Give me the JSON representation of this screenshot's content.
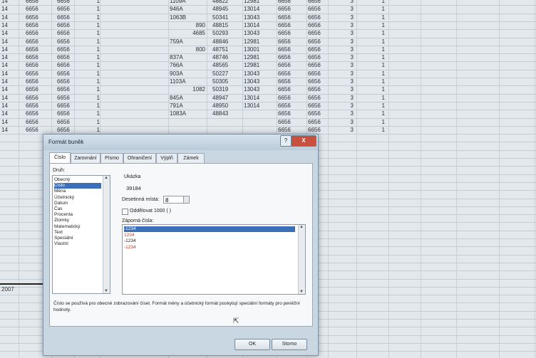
{
  "spreadsheet": {
    "left_rows": [
      [
        "14",
        "6656",
        "6656",
        "1"
      ],
      [
        "14",
        "6656",
        "6656",
        "1"
      ],
      [
        "14",
        "6656",
        "6656",
        "1"
      ],
      [
        "14",
        "6656",
        "6656",
        "1"
      ],
      [
        "14",
        "6656",
        "6656",
        "1"
      ],
      [
        "14",
        "6656",
        "6656",
        "1"
      ],
      [
        "14",
        "6656",
        "6656",
        "1"
      ],
      [
        "14",
        "6656",
        "6656",
        "1"
      ],
      [
        "14",
        "6656",
        "6656",
        "1"
      ],
      [
        "14",
        "6656",
        "6656",
        "1"
      ],
      [
        "14",
        "6656",
        "6656",
        "1"
      ],
      [
        "14",
        "6656",
        "6656",
        "1"
      ],
      [
        "14",
        "6656",
        "6656",
        "1"
      ],
      [
        "14",
        "6656",
        "6656",
        "1"
      ],
      [
        "14",
        "6656",
        "6656",
        "1"
      ],
      [
        "14",
        "6656",
        "6656",
        "1"
      ],
      [
        "14",
        "6656",
        "6656",
        "1"
      ]
    ],
    "right_rows": [
      [
        "1109A",
        "48822",
        "12981",
        "6656",
        "6656",
        "3",
        "1"
      ],
      [
        "946A",
        "48945",
        "13014",
        "6656",
        "6656",
        "3",
        "1"
      ],
      [
        "1063B",
        "50341",
        "13043",
        "6656",
        "6656",
        "3",
        "1"
      ],
      [
        "890",
        "48815",
        "13014",
        "6656",
        "6656",
        "3",
        "1"
      ],
      [
        "4685",
        "50293",
        "13043",
        "6656",
        "6656",
        "3",
        "1"
      ],
      [
        "759A",
        "48846",
        "12981",
        "6656",
        "6656",
        "3",
        "1"
      ],
      [
        "800",
        "48751",
        "13001",
        "6656",
        "6656",
        "3",
        "1"
      ],
      [
        "837A",
        "48746",
        "12981",
        "6656",
        "6656",
        "3",
        "1"
      ],
      [
        "766A",
        "48565",
        "12981",
        "6656",
        "6656",
        "3",
        "1"
      ],
      [
        "903A",
        "50227",
        "13043",
        "6656",
        "6656",
        "3",
        "1"
      ],
      [
        "1103A",
        "50305",
        "13043",
        "6656",
        "6656",
        "3",
        "1"
      ],
      [
        "1082",
        "50319",
        "13043",
        "6656",
        "6656",
        "3",
        "1"
      ],
      [
        "845A",
        "48947",
        "13014",
        "6656",
        "6656",
        "3",
        "1"
      ],
      [
        "791A",
        "48950",
        "13014",
        "6656",
        "6656",
        "3",
        "1"
      ],
      [
        "1083A",
        "48843",
        "",
        "6656",
        "6656",
        "3",
        "1"
      ],
      [
        "",
        "",
        "",
        "6656",
        "6656",
        "3",
        "1"
      ],
      [
        "",
        "",
        "",
        "6656",
        "6656",
        "3",
        "1"
      ]
    ],
    "year_label": "2007"
  },
  "dialog": {
    "title": "Formát buněk",
    "help_label": "?",
    "close_label": "X",
    "tabs": [
      "Číslo",
      "Zarovnání",
      "Písmo",
      "Ohraničení",
      "Výplň",
      "Zámek"
    ],
    "category_label": "Druh:",
    "categories": [
      "Obecný",
      "Číslo",
      "Měna",
      "Účetnický",
      "Datum",
      "Čas",
      "Procenta",
      "Zlomky",
      "Matematický",
      "Text",
      "Speciální",
      "Vlastní"
    ],
    "sample_label": "Ukázka",
    "sample_value": "39184",
    "decimals_label": "Desetinná místa:",
    "decimals_value": "8",
    "thousands_label": "Oddělovat 1000 ( )",
    "negative_label": "Záporná čísla:",
    "negative_options": [
      "-1234",
      "1234",
      "-1234",
      "-1234"
    ],
    "description": "Číslo se používá pro obecné zobrazování čísel. Formát měny a účetnický formát poskytují speciální formáty pro peněžní hodnoty.",
    "ok_label": "OK",
    "cancel_label": "Storno"
  },
  "colors": {
    "selection": "#3d6fb8",
    "negative_red": "#c0392b",
    "close_button": "#c8503e"
  }
}
